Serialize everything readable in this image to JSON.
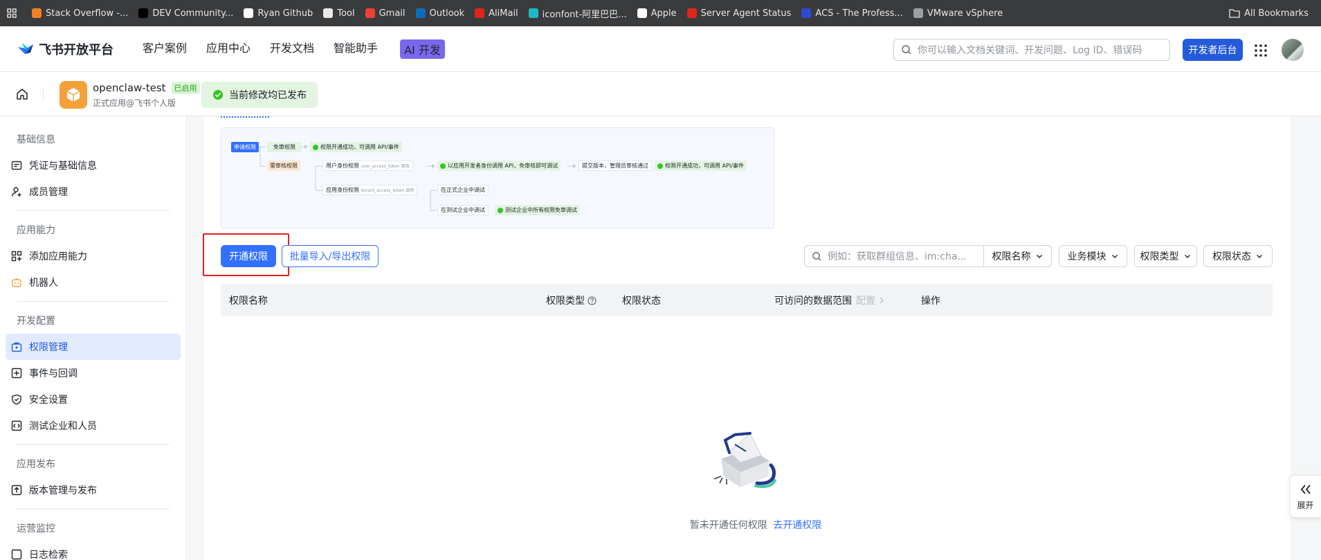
{
  "bookmarks": [
    {
      "label": "Stack Overflow -...",
      "color": "#f48024"
    },
    {
      "label": "DEV Community...",
      "color": "#000000"
    },
    {
      "label": "Ryan Github",
      "color": "#ffffff"
    },
    {
      "label": "Tool",
      "color": "#e8e8e8"
    },
    {
      "label": "Gmail",
      "color": "#ea4335"
    },
    {
      "label": "Outlook",
      "color": "#0f6cbd"
    },
    {
      "label": "AliMail",
      "color": "#e1251b"
    },
    {
      "label": "iconfont-阿里巴巴...",
      "color": "#1fb8c4"
    },
    {
      "label": "Apple",
      "color": "#ffffff"
    },
    {
      "label": "Server Agent Status",
      "color": "#e1251b"
    },
    {
      "label": "ACS - The Profess...",
      "color": "#2b4bd6"
    },
    {
      "label": "VMware vSphere",
      "color": "#9aa0a6"
    }
  ],
  "all_bookmarks": "All Bookmarks",
  "topnav": {
    "logo": "飞书开放平台",
    "links": [
      "客户案例",
      "应用中心",
      "开发文档",
      "智能助手"
    ],
    "ai_badge": "AI 开发",
    "search_placeholder": "你可以输入文档关键词、开发问题、Log ID、错误码",
    "dev_button": "开发者后台"
  },
  "app": {
    "name": "openclaw-test",
    "status": "已启用",
    "subtitle": "正式应用@飞书个人版",
    "publish_notice": "当前修改均已发布"
  },
  "sidebar": {
    "sections": [
      {
        "title": "基础信息",
        "items": [
          "凭证与基础信息",
          "成员管理"
        ]
      },
      {
        "title": "应用能力",
        "items": [
          "添加应用能力",
          "机器人"
        ]
      },
      {
        "title": "开发配置",
        "items": [
          "权限管理",
          "事件与回调",
          "安全设置",
          "测试企业和人员"
        ]
      },
      {
        "title": "应用发布",
        "items": [
          "版本管理与发布"
        ]
      },
      {
        "title": "运营监控",
        "items": [
          "日志检索"
        ]
      }
    ],
    "active": "权限管理"
  },
  "flow": {
    "apply": "申请权限",
    "free": "免审权限",
    "free_result": "权限开通成功，可调用 API/事件",
    "review": "需审核权限",
    "user_token": "用户身份权限",
    "user_token_sub": "user_access_token 调用",
    "dev_identity": "以应用开发者身份调用 API，免审核即可调试",
    "submit": "提交版本，管理员审核通过",
    "final_result": "权限开通成功，可调用 API/事件",
    "tenant_token": "应用身份权限",
    "tenant_token_sub": "tenant_access_token 调用",
    "prod_debug": "在正式企业中调试",
    "test_debug": "在测试企业中调试",
    "test_result": "测试企业中所有权限免审调试"
  },
  "toolbar": {
    "enable_button": "开通权限",
    "batch_button": "批量导入/导出权限",
    "search_placeholder": "例如：获取群组信息、im:cha...",
    "filters": [
      "权限名称",
      "业务模块",
      "权限类型",
      "权限状态"
    ]
  },
  "table": {
    "headers": [
      "权限名称",
      "权限类型",
      "权限状态",
      "可访问的数据范围",
      "操作"
    ],
    "config_hint": "配置"
  },
  "empty": {
    "text": "暂未开通任何权限",
    "link": "去开通权限"
  },
  "expand": "展开"
}
